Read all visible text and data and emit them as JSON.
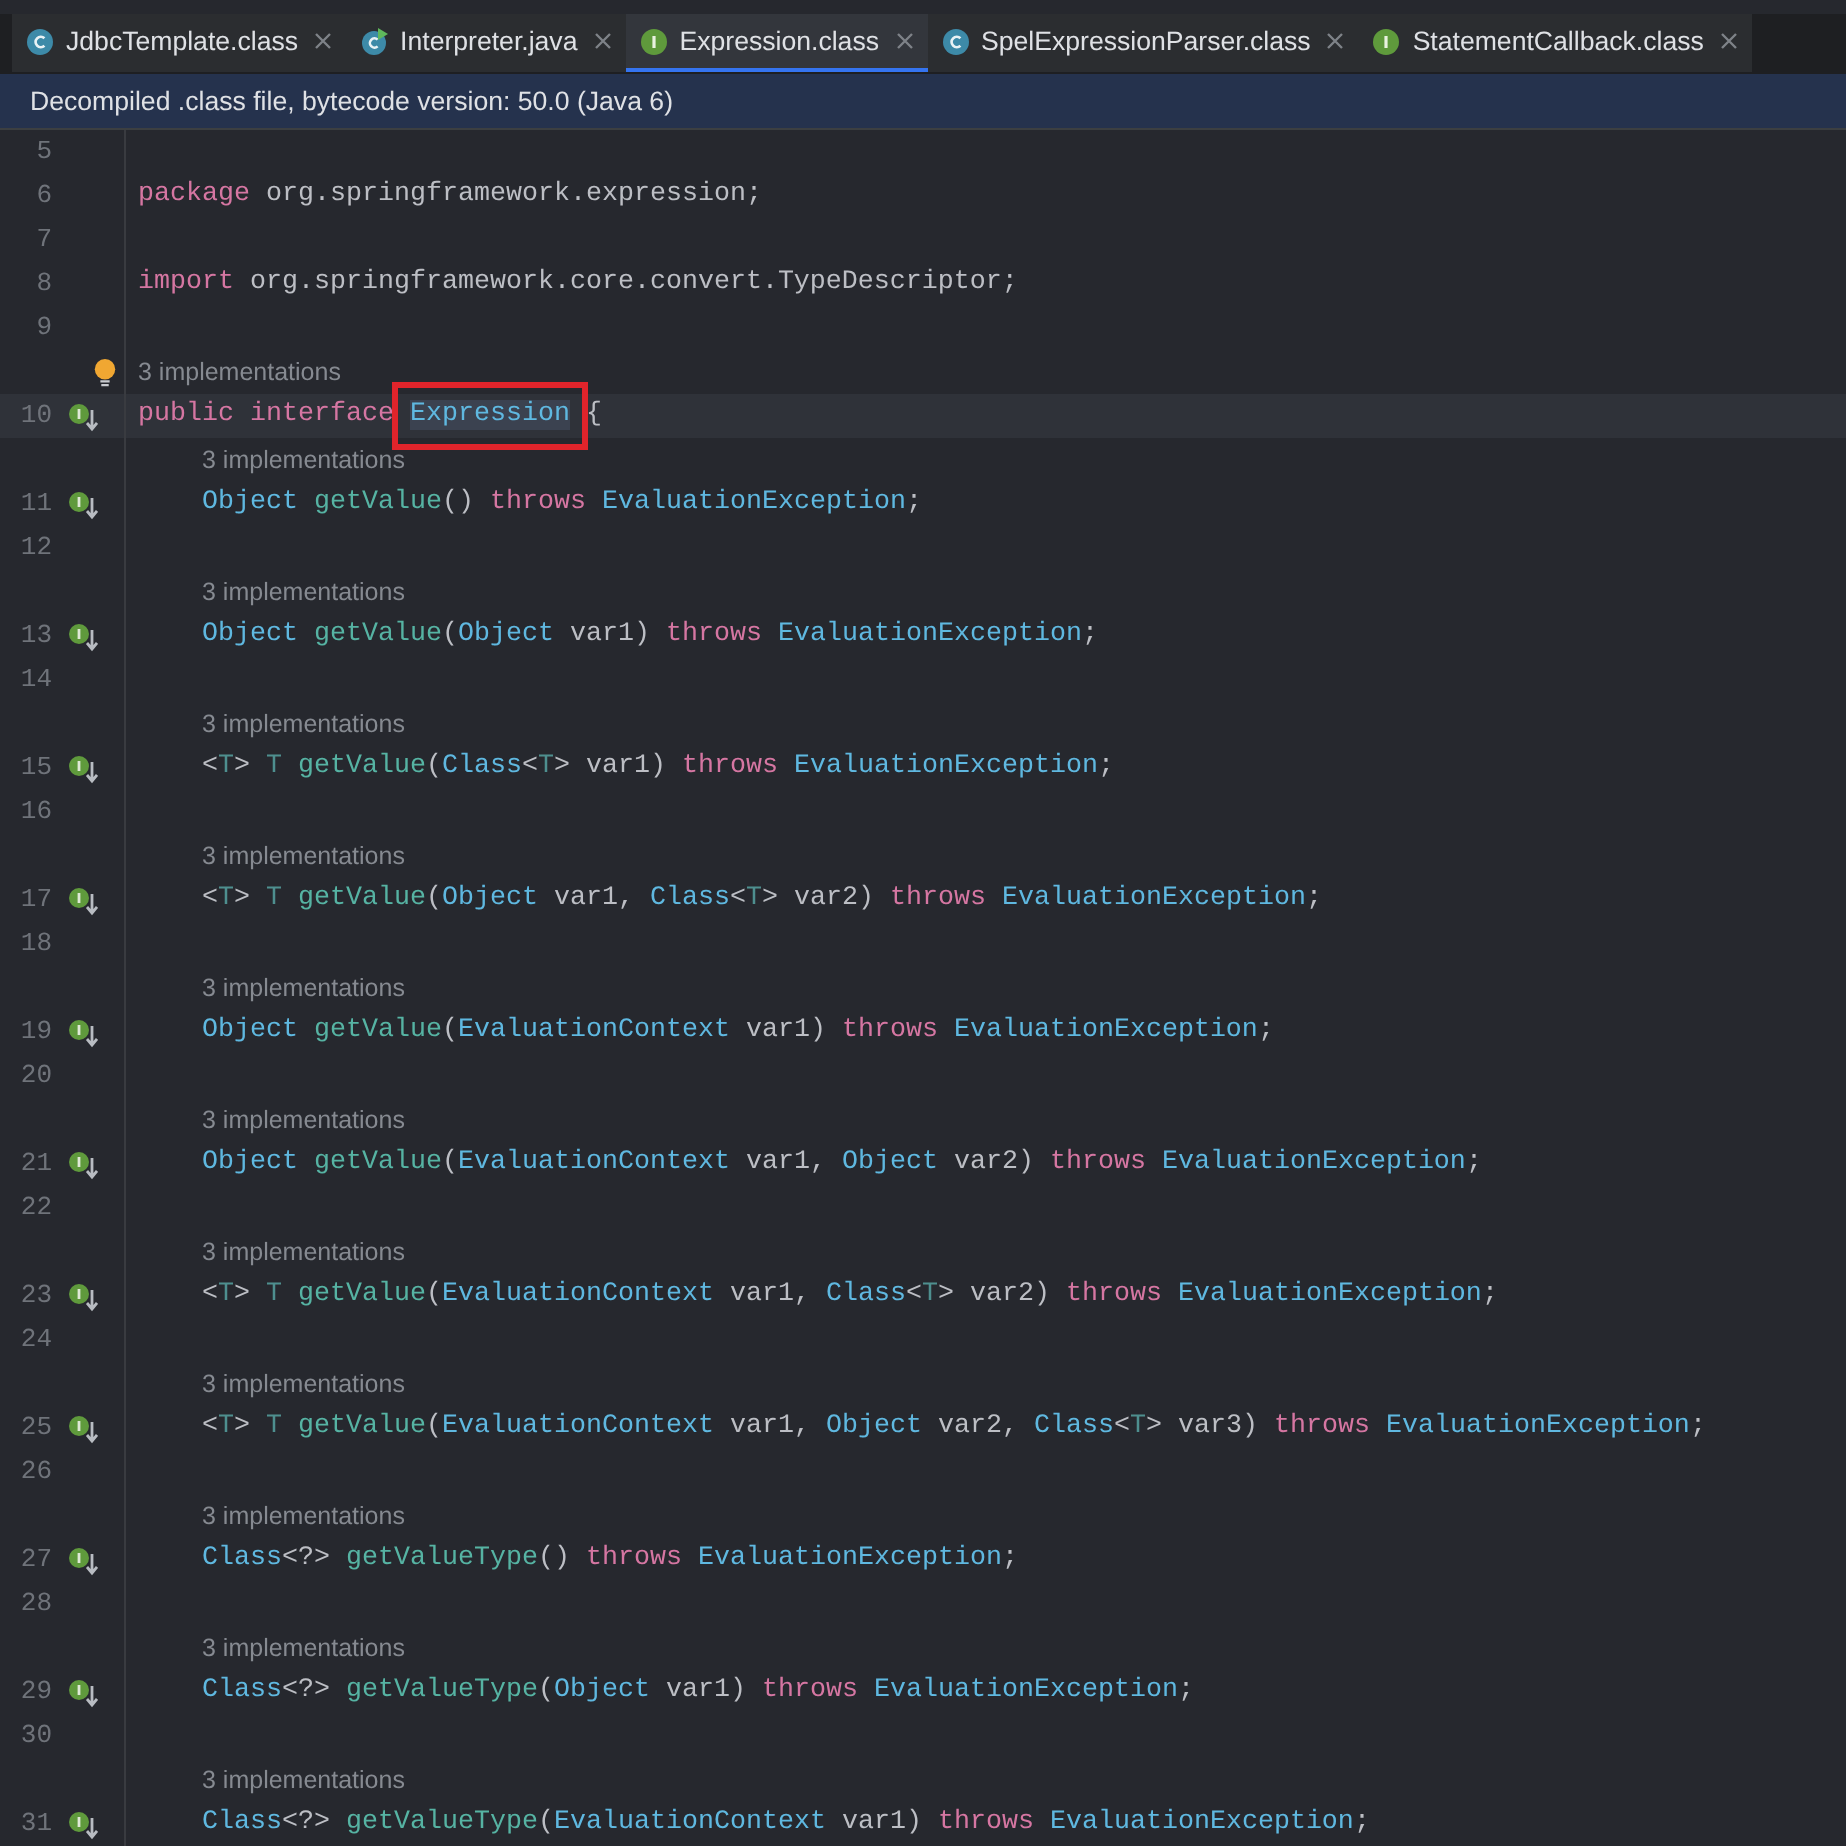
{
  "tabs": [
    {
      "label": "JdbcTemplate.class",
      "kind": "class",
      "selected": false
    },
    {
      "label": "Interpreter.java",
      "kind": "runnable",
      "selected": false
    },
    {
      "label": "Expression.class",
      "kind": "interface",
      "selected": true
    },
    {
      "label": "SpelExpressionParser.class",
      "kind": "class",
      "selected": false
    },
    {
      "label": "StatementCallback.class",
      "kind": "interface",
      "selected": false
    }
  ],
  "info_bar": "Decompiled .class file, bytecode version: 50.0 (Java 6)",
  "editor": {
    "rows": [
      {
        "kind": "line",
        "number": "5",
        "tokens": []
      },
      {
        "kind": "line",
        "number": "6",
        "tokens": [
          {
            "kind": "keyword",
            "text": "package"
          },
          {
            "kind": "plain",
            "text": " org.springframework.expression;"
          }
        ]
      },
      {
        "kind": "line",
        "number": "7",
        "tokens": []
      },
      {
        "kind": "line",
        "number": "8",
        "tokens": [
          {
            "kind": "keyword",
            "text": "import"
          },
          {
            "kind": "plain",
            "text": " org.springframework.core.convert.TypeDescriptor;"
          }
        ]
      },
      {
        "kind": "line",
        "number": "9",
        "tokens": []
      },
      {
        "kind": "hint",
        "text": "3 implementations",
        "bulb": true
      },
      {
        "kind": "line",
        "number": "10",
        "current": true,
        "implemented": true,
        "tokens": [
          {
            "kind": "keyword",
            "text": "public interface "
          },
          {
            "kind": "declaration",
            "text": "Expression",
            "boxed": true
          },
          {
            "kind": "plain",
            "text": " {"
          }
        ]
      },
      {
        "kind": "hint",
        "text": "3 implementations",
        "indented": true
      },
      {
        "kind": "line",
        "number": "11",
        "indented": true,
        "implemented": true,
        "tokens": [
          {
            "kind": "type",
            "text": "Object"
          },
          {
            "kind": "method",
            "text": " getValue"
          },
          {
            "kind": "plain",
            "text": "() "
          },
          {
            "kind": "keyword",
            "text": "throws"
          },
          {
            "kind": "type",
            "text": " EvaluationException"
          },
          {
            "kind": "plain",
            "text": ";"
          }
        ]
      },
      {
        "kind": "line",
        "number": "12",
        "tokens": []
      },
      {
        "kind": "hint",
        "text": "3 implementations",
        "indented": true
      },
      {
        "kind": "line",
        "number": "13",
        "indented": true,
        "implemented": true,
        "tokens": [
          {
            "kind": "type",
            "text": "Object"
          },
          {
            "kind": "method",
            "text": " getValue"
          },
          {
            "kind": "plain",
            "text": "("
          },
          {
            "kind": "type",
            "text": "Object"
          },
          {
            "kind": "plain",
            "text": " var1) "
          },
          {
            "kind": "keyword",
            "text": "throws"
          },
          {
            "kind": "type",
            "text": " EvaluationException"
          },
          {
            "kind": "plain",
            "text": ";"
          }
        ]
      },
      {
        "kind": "line",
        "number": "14",
        "tokens": []
      },
      {
        "kind": "hint",
        "text": "3 implementations",
        "indented": true
      },
      {
        "kind": "line",
        "number": "15",
        "indented": true,
        "implemented": true,
        "tokens": [
          {
            "kind": "plain",
            "text": "<"
          },
          {
            "kind": "typeparam",
            "text": "T"
          },
          {
            "kind": "plain",
            "text": "> "
          },
          {
            "kind": "typeparam",
            "text": "T"
          },
          {
            "kind": "method",
            "text": " getValue"
          },
          {
            "kind": "plain",
            "text": "("
          },
          {
            "kind": "type",
            "text": "Class"
          },
          {
            "kind": "plain",
            "text": "<"
          },
          {
            "kind": "typeparam",
            "text": "T"
          },
          {
            "kind": "plain",
            "text": "> var1) "
          },
          {
            "kind": "keyword",
            "text": "throws"
          },
          {
            "kind": "type",
            "text": " EvaluationException"
          },
          {
            "kind": "plain",
            "text": ";"
          }
        ]
      },
      {
        "kind": "line",
        "number": "16",
        "tokens": []
      },
      {
        "kind": "hint",
        "text": "3 implementations",
        "indented": true
      },
      {
        "kind": "line",
        "number": "17",
        "indented": true,
        "implemented": true,
        "tokens": [
          {
            "kind": "plain",
            "text": "<"
          },
          {
            "kind": "typeparam",
            "text": "T"
          },
          {
            "kind": "plain",
            "text": "> "
          },
          {
            "kind": "typeparam",
            "text": "T"
          },
          {
            "kind": "method",
            "text": " getValue"
          },
          {
            "kind": "plain",
            "text": "("
          },
          {
            "kind": "type",
            "text": "Object"
          },
          {
            "kind": "plain",
            "text": " var1, "
          },
          {
            "kind": "type",
            "text": "Class"
          },
          {
            "kind": "plain",
            "text": "<"
          },
          {
            "kind": "typeparam",
            "text": "T"
          },
          {
            "kind": "plain",
            "text": "> var2) "
          },
          {
            "kind": "keyword",
            "text": "throws"
          },
          {
            "kind": "type",
            "text": " EvaluationException"
          },
          {
            "kind": "plain",
            "text": ";"
          }
        ]
      },
      {
        "kind": "line",
        "number": "18",
        "tokens": []
      },
      {
        "kind": "hint",
        "text": "3 implementations",
        "indented": true
      },
      {
        "kind": "line",
        "number": "19",
        "indented": true,
        "implemented": true,
        "tokens": [
          {
            "kind": "type",
            "text": "Object"
          },
          {
            "kind": "method",
            "text": " getValue"
          },
          {
            "kind": "plain",
            "text": "("
          },
          {
            "kind": "type",
            "text": "EvaluationContext"
          },
          {
            "kind": "plain",
            "text": " var1) "
          },
          {
            "kind": "keyword",
            "text": "throws"
          },
          {
            "kind": "type",
            "text": " EvaluationException"
          },
          {
            "kind": "plain",
            "text": ";"
          }
        ]
      },
      {
        "kind": "line",
        "number": "20",
        "tokens": []
      },
      {
        "kind": "hint",
        "text": "3 implementations",
        "indented": true
      },
      {
        "kind": "line",
        "number": "21",
        "indented": true,
        "implemented": true,
        "tokens": [
          {
            "kind": "type",
            "text": "Object"
          },
          {
            "kind": "method",
            "text": " getValue"
          },
          {
            "kind": "plain",
            "text": "("
          },
          {
            "kind": "type",
            "text": "EvaluationContext"
          },
          {
            "kind": "plain",
            "text": " var1, "
          },
          {
            "kind": "type",
            "text": "Object"
          },
          {
            "kind": "plain",
            "text": " var2) "
          },
          {
            "kind": "keyword",
            "text": "throws"
          },
          {
            "kind": "type",
            "text": " EvaluationException"
          },
          {
            "kind": "plain",
            "text": ";"
          }
        ]
      },
      {
        "kind": "line",
        "number": "22",
        "tokens": []
      },
      {
        "kind": "hint",
        "text": "3 implementations",
        "indented": true
      },
      {
        "kind": "line",
        "number": "23",
        "indented": true,
        "implemented": true,
        "tokens": [
          {
            "kind": "plain",
            "text": "<"
          },
          {
            "kind": "typeparam",
            "text": "T"
          },
          {
            "kind": "plain",
            "text": "> "
          },
          {
            "kind": "typeparam",
            "text": "T"
          },
          {
            "kind": "method",
            "text": " getValue"
          },
          {
            "kind": "plain",
            "text": "("
          },
          {
            "kind": "type",
            "text": "EvaluationContext"
          },
          {
            "kind": "plain",
            "text": " var1, "
          },
          {
            "kind": "type",
            "text": "Class"
          },
          {
            "kind": "plain",
            "text": "<"
          },
          {
            "kind": "typeparam",
            "text": "T"
          },
          {
            "kind": "plain",
            "text": "> var2) "
          },
          {
            "kind": "keyword",
            "text": "throws"
          },
          {
            "kind": "type",
            "text": " EvaluationException"
          },
          {
            "kind": "plain",
            "text": ";"
          }
        ]
      },
      {
        "kind": "line",
        "number": "24",
        "tokens": []
      },
      {
        "kind": "hint",
        "text": "3 implementations",
        "indented": true
      },
      {
        "kind": "line",
        "number": "25",
        "indented": true,
        "implemented": true,
        "tokens": [
          {
            "kind": "plain",
            "text": "<"
          },
          {
            "kind": "typeparam",
            "text": "T"
          },
          {
            "kind": "plain",
            "text": "> "
          },
          {
            "kind": "typeparam",
            "text": "T"
          },
          {
            "kind": "method",
            "text": " getValue"
          },
          {
            "kind": "plain",
            "text": "("
          },
          {
            "kind": "type",
            "text": "EvaluationContext"
          },
          {
            "kind": "plain",
            "text": " var1, "
          },
          {
            "kind": "type",
            "text": "Object"
          },
          {
            "kind": "plain",
            "text": " var2, "
          },
          {
            "kind": "type",
            "text": "Class"
          },
          {
            "kind": "plain",
            "text": "<"
          },
          {
            "kind": "typeparam",
            "text": "T"
          },
          {
            "kind": "plain",
            "text": "> var3) "
          },
          {
            "kind": "keyword",
            "text": "throws"
          },
          {
            "kind": "type",
            "text": " EvaluationException"
          },
          {
            "kind": "plain",
            "text": ";"
          }
        ]
      },
      {
        "kind": "line",
        "number": "26",
        "tokens": []
      },
      {
        "kind": "hint",
        "text": "3 implementations",
        "indented": true
      },
      {
        "kind": "line",
        "number": "27",
        "indented": true,
        "implemented": true,
        "tokens": [
          {
            "kind": "type",
            "text": "Class"
          },
          {
            "kind": "plain",
            "text": "<?> "
          },
          {
            "kind": "method",
            "text": "getValueType"
          },
          {
            "kind": "plain",
            "text": "() "
          },
          {
            "kind": "keyword",
            "text": "throws"
          },
          {
            "kind": "type",
            "text": " EvaluationException"
          },
          {
            "kind": "plain",
            "text": ";"
          }
        ]
      },
      {
        "kind": "line",
        "number": "28",
        "tokens": []
      },
      {
        "kind": "hint",
        "text": "3 implementations",
        "indented": true
      },
      {
        "kind": "line",
        "number": "29",
        "indented": true,
        "implemented": true,
        "tokens": [
          {
            "kind": "type",
            "text": "Class"
          },
          {
            "kind": "plain",
            "text": "<?> "
          },
          {
            "kind": "method",
            "text": "getValueType"
          },
          {
            "kind": "plain",
            "text": "("
          },
          {
            "kind": "type",
            "text": "Object"
          },
          {
            "kind": "plain",
            "text": " var1) "
          },
          {
            "kind": "keyword",
            "text": "throws"
          },
          {
            "kind": "type",
            "text": " EvaluationException"
          },
          {
            "kind": "plain",
            "text": ";"
          }
        ]
      },
      {
        "kind": "line",
        "number": "30",
        "tokens": []
      },
      {
        "kind": "hint",
        "text": "3 implementations",
        "indented": true
      },
      {
        "kind": "line",
        "number": "31",
        "indented": true,
        "implemented": true,
        "tokens": [
          {
            "kind": "type",
            "text": "Class"
          },
          {
            "kind": "plain",
            "text": "<?> "
          },
          {
            "kind": "method",
            "text": "getValueType"
          },
          {
            "kind": "plain",
            "text": "("
          },
          {
            "kind": "type",
            "text": "EvaluationContext"
          },
          {
            "kind": "plain",
            "text": " var1) "
          },
          {
            "kind": "keyword",
            "text": "throws"
          },
          {
            "kind": "type",
            "text": " EvaluationException"
          },
          {
            "kind": "plain",
            "text": ";"
          }
        ]
      }
    ]
  }
}
